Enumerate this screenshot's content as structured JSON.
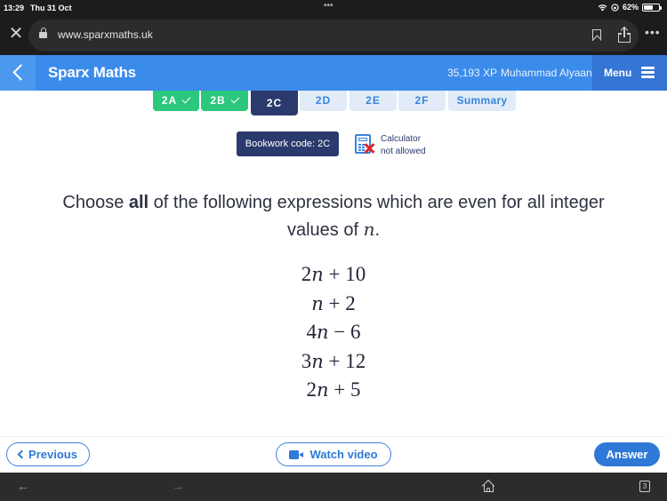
{
  "status_bar": {
    "time": "13:29",
    "date": "Thu 31 Oct",
    "battery_percent": "62%",
    "battery_level": 0.62
  },
  "browser": {
    "url": "www.sparxmaths.uk",
    "more_label": "•••"
  },
  "header": {
    "title": "Sparx Maths",
    "xp": "35,193 XP",
    "user_name": "Muhammad Alyaan",
    "menu_label": "Menu"
  },
  "tabs": [
    {
      "label": "2A",
      "state": "done"
    },
    {
      "label": "2B",
      "state": "done"
    },
    {
      "label": "2C",
      "state": "current"
    },
    {
      "label": "2D",
      "state": "todo"
    },
    {
      "label": "2E",
      "state": "todo"
    },
    {
      "label": "2F",
      "state": "todo"
    },
    {
      "label": "Summary",
      "state": "todo"
    }
  ],
  "bookwork": {
    "code_label": "Bookwork code: 2C",
    "calculator_line1": "Calculator",
    "calculator_line2": "not allowed"
  },
  "question": {
    "prefix": "Choose ",
    "emphasis": "all",
    "middle": " of the following expressions which are even for all integer values of ",
    "variable": "n",
    "suffix": "."
  },
  "expressions": [
    {
      "coef": "2",
      "var": "n",
      "op": "+",
      "const": "10"
    },
    {
      "coef": "",
      "var": "n",
      "op": "+",
      "const": "2"
    },
    {
      "coef": "4",
      "var": "n",
      "op": "−",
      "const": "6"
    },
    {
      "coef": "3",
      "var": "n",
      "op": "+",
      "const": "12"
    },
    {
      "coef": "2",
      "var": "n",
      "op": "+",
      "const": "5"
    }
  ],
  "footer": {
    "previous_label": "Previous",
    "video_label": "Watch video",
    "answer_label": "Answer"
  },
  "bottom_bar": {
    "back_arrow": "←",
    "forward_arrow": "→",
    "tab_count": "3"
  },
  "colors": {
    "header_blue": "#3b8beb",
    "menu_blue": "#3575d3",
    "done_green": "#2bc77d",
    "current_navy": "#2b3a6d",
    "todo_bg": "#e1ecf8",
    "accent_blue": "#2e79d6",
    "calc_cross_red": "#e0242a"
  }
}
